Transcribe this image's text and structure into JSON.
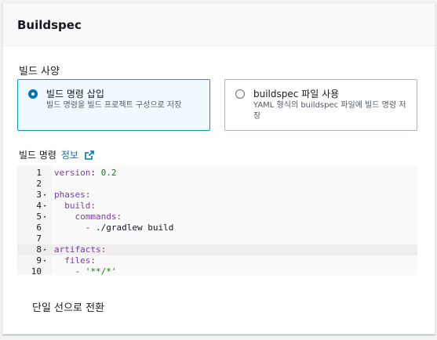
{
  "panel": {
    "title": "Buildspec"
  },
  "section": {
    "label": "빌드 사양"
  },
  "options": [
    {
      "title": "빌드 명령 삽입",
      "desc": "빌드 명령을 빌드 프로젝트 구성으로 저장",
      "selected": true
    },
    {
      "title": "buildspec 파일 사용",
      "desc": "YAML 형식의 buildspec 파일에 빌드 명령 저장",
      "selected": false
    }
  ],
  "commands": {
    "label": "빌드 명령",
    "info": "정보"
  },
  "editor": {
    "lines": [
      {
        "n": "1",
        "fold": "",
        "tokens": [
          [
            "version",
            "k"
          ],
          [
            ": ",
            ""
          ],
          [
            "0.2",
            "n"
          ]
        ]
      },
      {
        "n": "2",
        "fold": "",
        "tokens": []
      },
      {
        "n": "3",
        "fold": "▾",
        "tokens": [
          [
            "phases",
            "k"
          ],
          [
            ":",
            "d"
          ]
        ]
      },
      {
        "n": "4",
        "fold": "▾",
        "tokens": [
          [
            "  build",
            "k"
          ],
          [
            ":",
            "d"
          ]
        ]
      },
      {
        "n": "5",
        "fold": "▾",
        "tokens": [
          [
            "    commands",
            "k"
          ],
          [
            ":",
            "d"
          ]
        ]
      },
      {
        "n": "6",
        "fold": "",
        "tokens": [
          [
            "      - ",
            "d"
          ],
          [
            "./gradlew build",
            ""
          ]
        ]
      },
      {
        "n": "7",
        "fold": "",
        "tokens": []
      },
      {
        "n": "8",
        "fold": "▾",
        "tokens": [
          [
            "artifacts",
            "k"
          ],
          [
            ":",
            "d"
          ]
        ]
      },
      {
        "n": "9",
        "fold": "▾",
        "tokens": [
          [
            "  files",
            "k"
          ],
          [
            ":",
            "d"
          ]
        ]
      },
      {
        "n": "10",
        "fold": "",
        "tokens": [
          [
            "    - ",
            "d"
          ],
          [
            "'**/*'",
            "n"
          ]
        ]
      }
    ]
  },
  "footer": {
    "switch_label": "단일 선으로 전환"
  }
}
